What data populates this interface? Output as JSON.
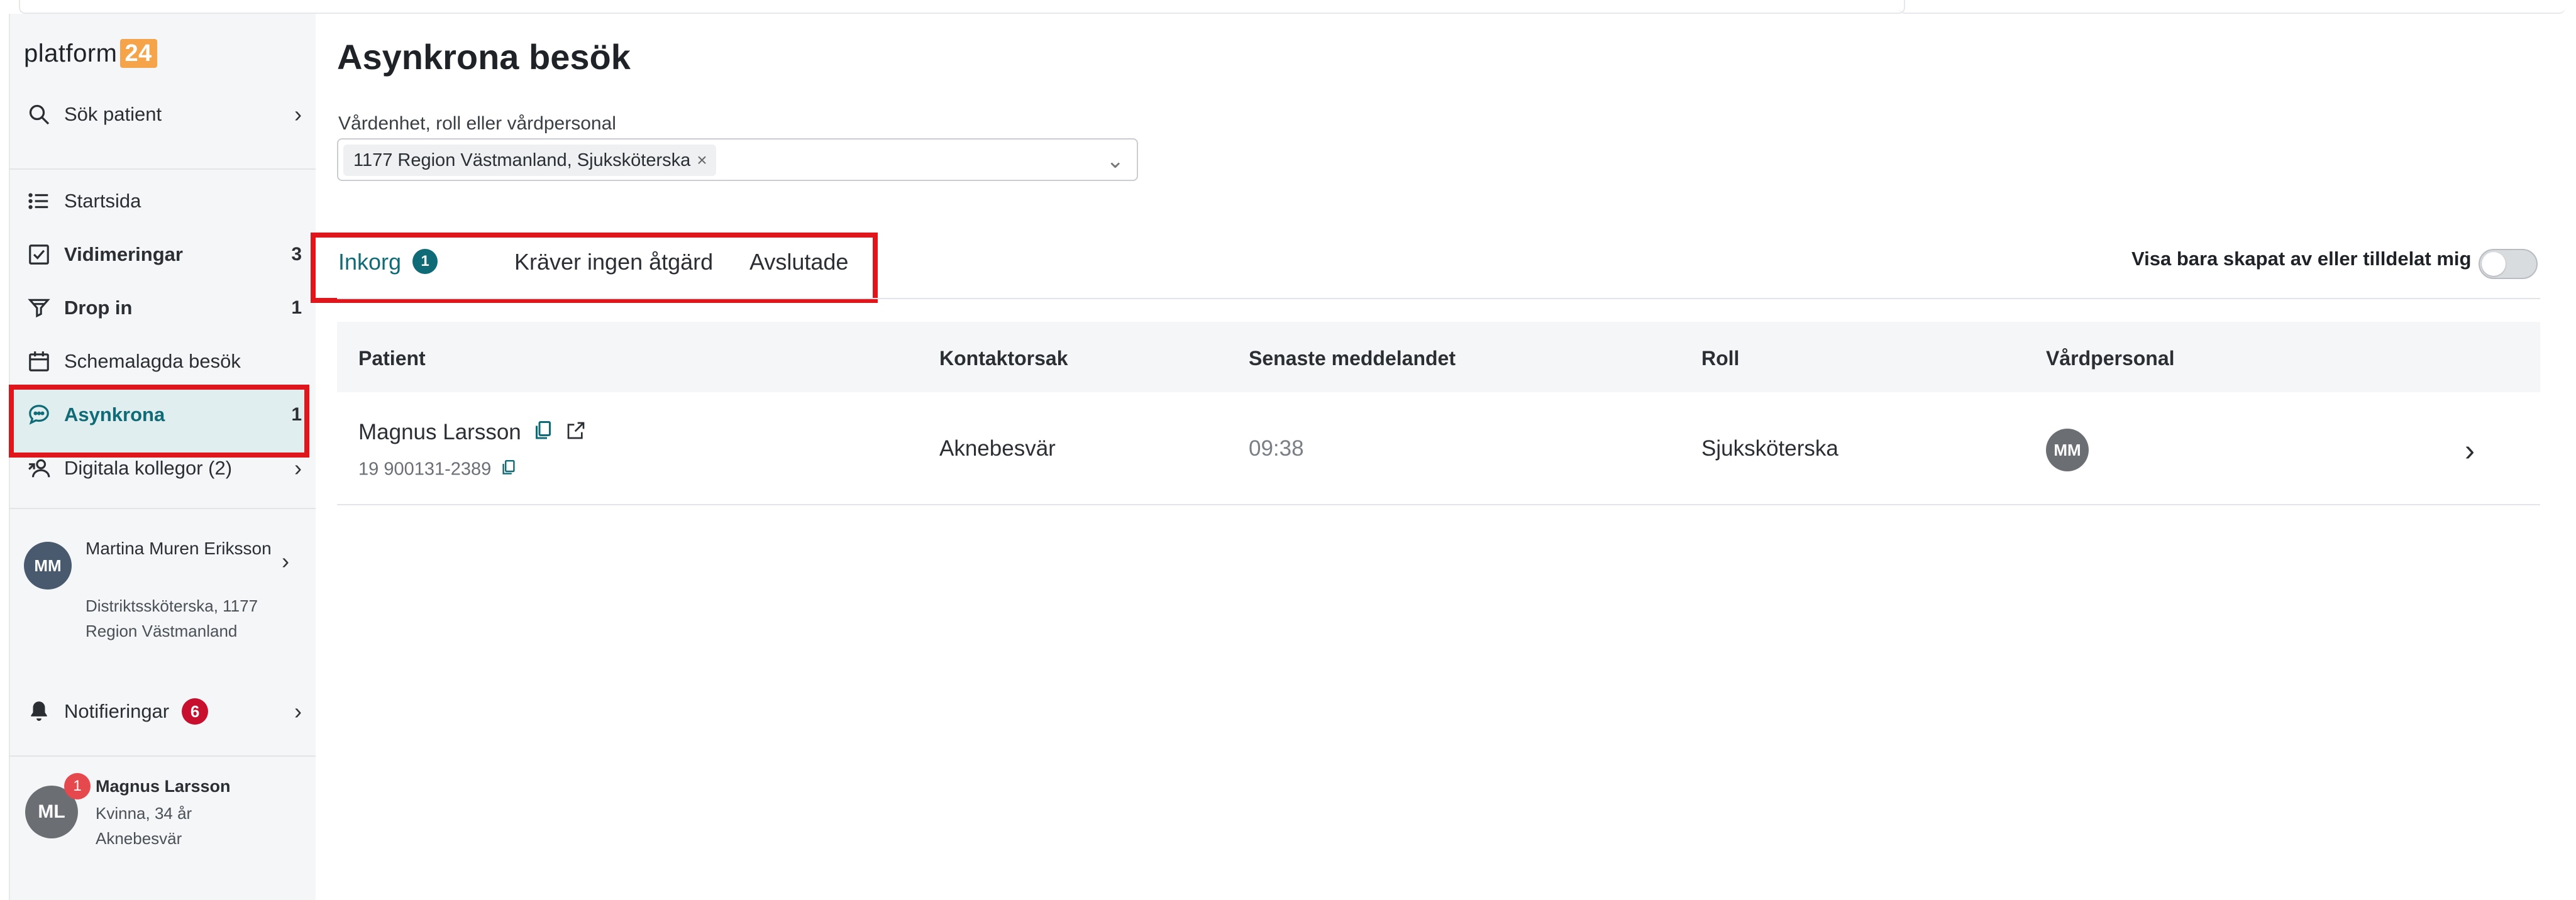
{
  "app": {
    "logo_text": "platform",
    "logo_badge": "24",
    "brand_color": "#f5a44a",
    "accent_color": "#0f6b75",
    "highlight_color": "#e0161d"
  },
  "sidebar": {
    "search": {
      "label": "Sök patient",
      "icon": "search-icon"
    },
    "items": [
      {
        "label": "Startsida",
        "icon": "list-icon",
        "count": ""
      },
      {
        "label": "Vidimeringar",
        "icon": "checkbox-icon",
        "count": "3"
      },
      {
        "label": "Drop in",
        "icon": "funnel-icon",
        "count": "1"
      },
      {
        "label": "Schemalagda besök",
        "icon": "calendar-icon",
        "count": ""
      },
      {
        "label": "Asynkrona",
        "icon": "chat-icon",
        "count": "1",
        "active": true
      },
      {
        "label": "Digitala kollegor (2)",
        "icon": "users-icon",
        "count": ""
      }
    ],
    "user": {
      "initials": "MM",
      "name": "Martina Muren Eriksson",
      "role": "Distriktssköterska, 1177 Region Västmanland"
    },
    "notifications": {
      "label": "Notifieringar",
      "count": "6",
      "icon": "bell-icon"
    },
    "current_patient": {
      "initials": "ML",
      "badge": "1",
      "name": "Magnus Larsson",
      "details": "Kvinna, 34 år",
      "reason": "Aknebesvär"
    }
  },
  "main": {
    "title": "Asynkrona besök",
    "filter": {
      "label": "Vårdenhet, roll eller vårdpersonal",
      "chip": "1177 Region Västmanland, Sjuksköterska",
      "chip_remove": "×"
    },
    "tabs": [
      {
        "label": "Inkorg",
        "badge": "1",
        "active": true
      },
      {
        "label": "Kräver ingen åtgärd"
      },
      {
        "label": "Avslutade"
      }
    ],
    "toggle": {
      "label": "Visa bara skapat av eller tilldelat mig",
      "on": false
    },
    "table": {
      "headers": [
        "Patient",
        "Kontaktorsak",
        "Senaste meddelandet",
        "Roll",
        "Vårdpersonal"
      ],
      "rows": [
        {
          "patient_name": "Magnus Larsson",
          "personnummer": "19 900131-2389",
          "kontaktorsak": "Aknebesvär",
          "senaste": "09:38",
          "roll": "Sjuksköterska",
          "vardpersonal": "MM"
        }
      ]
    }
  }
}
